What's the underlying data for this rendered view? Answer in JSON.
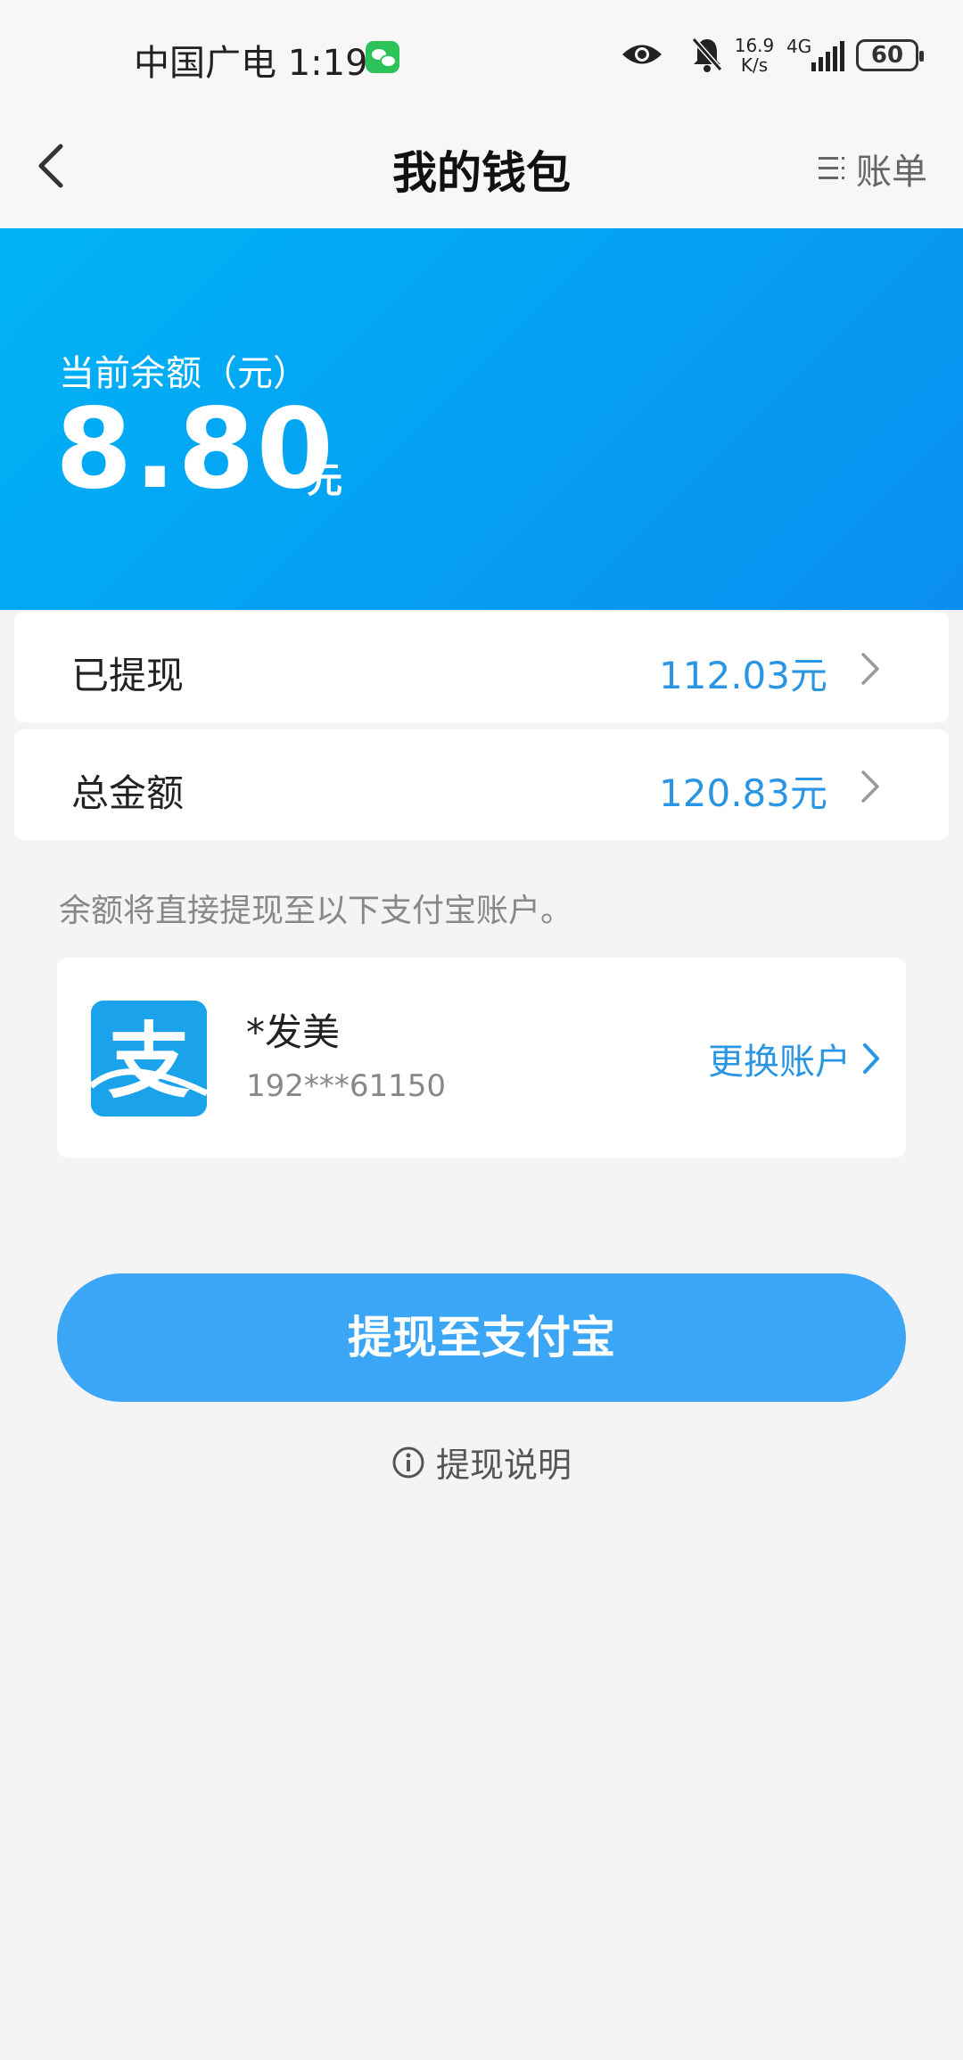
{
  "status_bar": {
    "carrier": "中国广电",
    "time": "1:19",
    "net_speed_value": "16.9",
    "net_speed_unit": "K/s",
    "network_type": "4G",
    "battery": "60",
    "icons": [
      "wechat-icon",
      "eye-icon",
      "bell-muted-icon",
      "signal-icon",
      "battery-icon"
    ]
  },
  "nav": {
    "title": "我的钱包",
    "bill_label": "账单",
    "back_icon": "chevron-left-icon",
    "bill_icon": "list-icon"
  },
  "balance": {
    "label": "当前余额（元）",
    "amount": "8.80",
    "unit": "元"
  },
  "stats": [
    {
      "label": "已提现",
      "value": "112.03元"
    },
    {
      "label": "总金额",
      "value": "120.83元"
    }
  ],
  "tip": "余额将直接提现至以下支付宝账户。",
  "account": {
    "logo_glyph": "支",
    "name": "*发美",
    "number": "192***61150",
    "change_label": "更换账户"
  },
  "withdraw": {
    "button_label": "提现至支付宝",
    "info_label": "提现说明"
  },
  "colors": {
    "accent": "#2a95e3",
    "banner_start": "#00b4f5",
    "banner_end": "#0a8ef0",
    "button": "#3aa6f5",
    "background": "#f4f4f5"
  }
}
